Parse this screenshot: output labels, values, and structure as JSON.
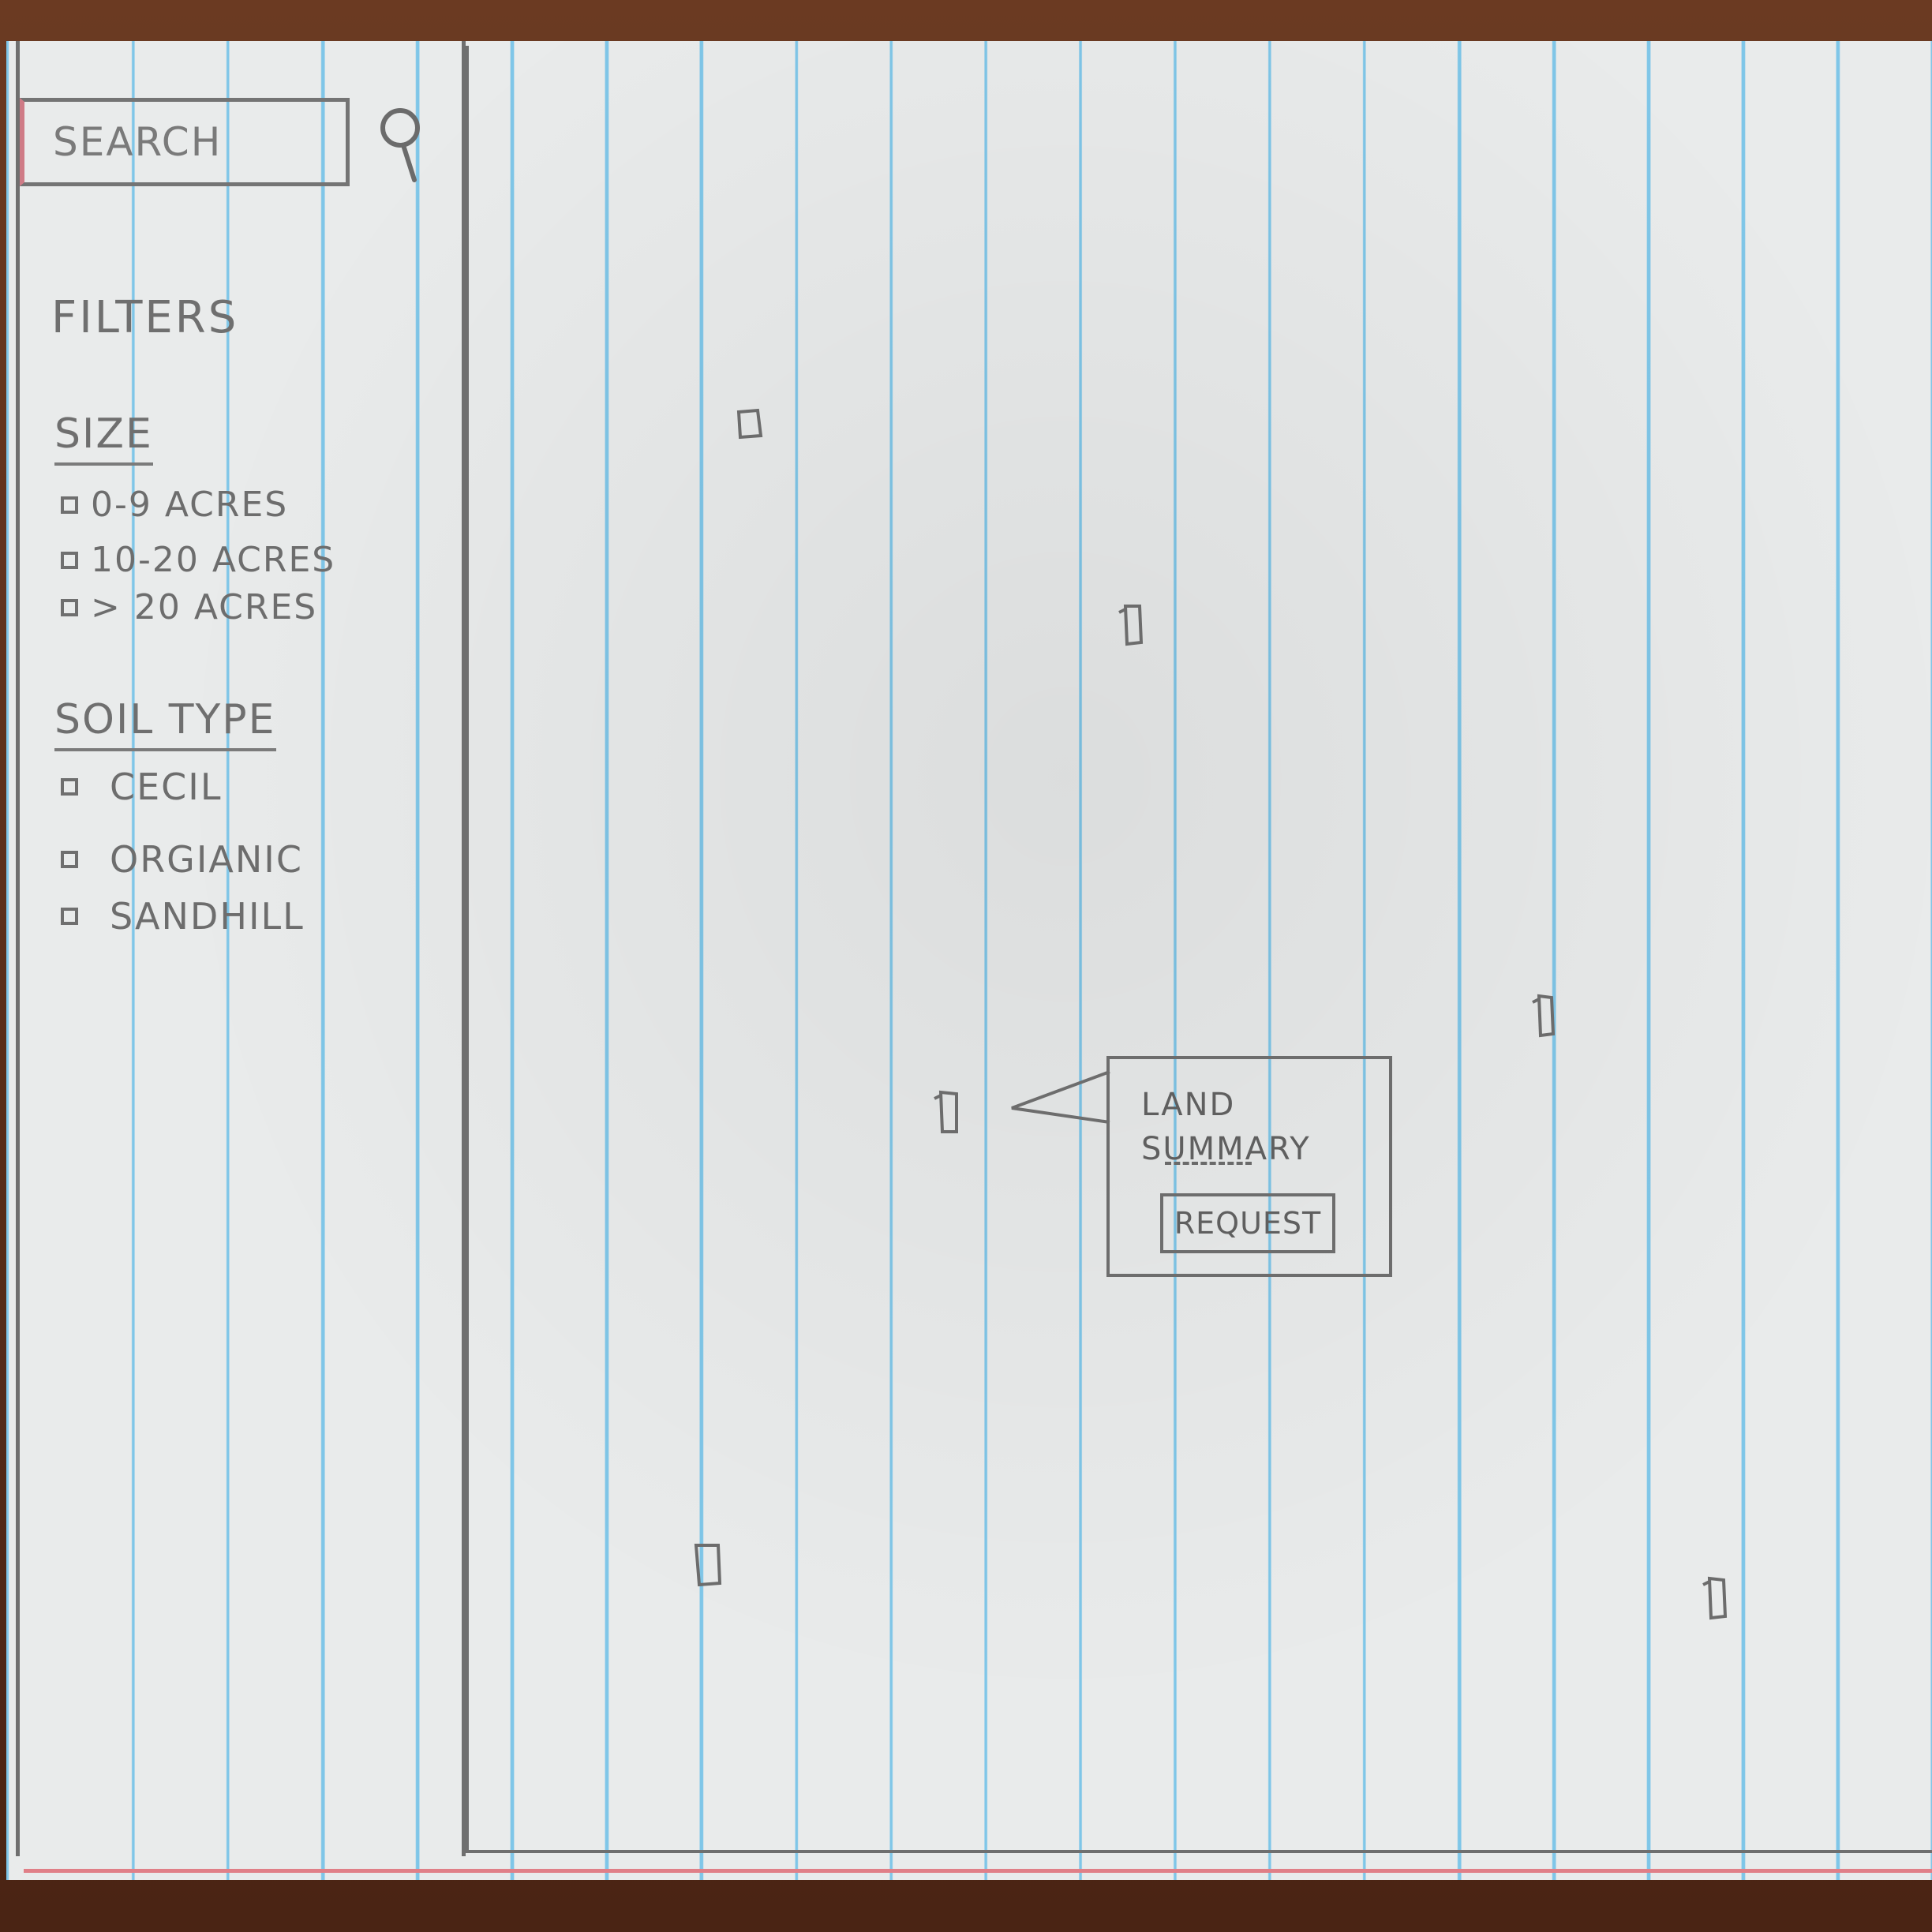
{
  "search": {
    "placeholder": "SEARCH"
  },
  "filters": {
    "title": "FILTERS",
    "size": {
      "title": "SIZE",
      "options": [
        "0-9 ACRES",
        "10-20 ACRES",
        "> 20 ACRES"
      ]
    },
    "soil_type": {
      "title": "SOIL TYPE",
      "options": [
        "CECIL",
        "ORGIANIC",
        "SANDHILL"
      ]
    }
  },
  "map": {
    "marker_icon": "land-marker-icon",
    "popup": {
      "title": "LAND SUMMARY",
      "request_label": "REQUEST"
    }
  }
}
